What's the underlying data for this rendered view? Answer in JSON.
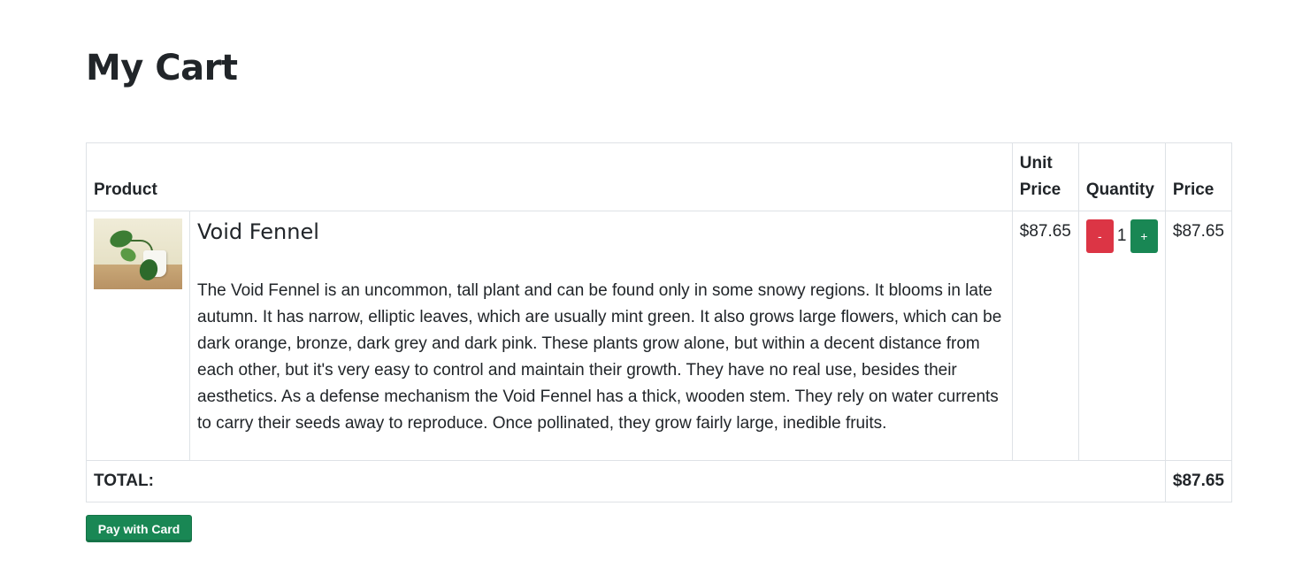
{
  "page": {
    "title": "My Cart"
  },
  "table": {
    "headers": {
      "product": "Product",
      "unit_price": "Unit Price",
      "quantity": "Quantity",
      "price": "Price"
    }
  },
  "items": [
    {
      "name": "Void Fennel",
      "description": "The Void Fennel is an uncommon, tall plant and can be found only in some snowy regions. It blooms in late autumn. It has narrow, elliptic leaves, which are usually mint green. It also grows large flowers, which can be dark orange, bronze, dark grey and dark pink. These plants grow alone, but within a decent distance from each other, but it's very easy to control and maintain their growth. They have no real use, besides their aesthetics. As a defense mechanism the Void Fennel has a thick, wooden stem. They rely on water currents to carry their seeds away to reproduce. Once pollinated, they grow fairly large, inedible fruits.",
      "unit_price": "$87.65",
      "quantity": "1",
      "price": "$87.65",
      "decrement_label": "-",
      "increment_label": "+",
      "image_icon": "plant-photo"
    }
  ],
  "footer": {
    "total_label": "TOTAL:",
    "total_value": "$87.65"
  },
  "actions": {
    "pay_label": "Pay with Card"
  },
  "colors": {
    "minus_button": "#dc3545",
    "plus_button": "#198754",
    "pay_button": "#198754",
    "border": "#dee2e6"
  }
}
